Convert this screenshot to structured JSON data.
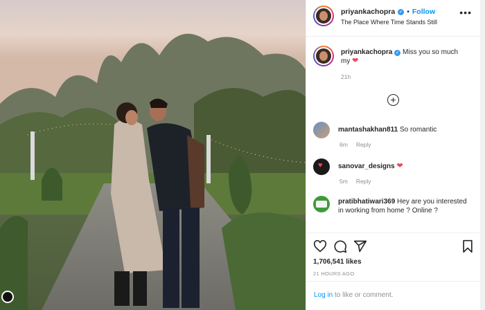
{
  "post": {
    "username": "priyankachopra",
    "follow_label": "Follow",
    "separator": "•",
    "location": "The Place Where Time Stands Still",
    "more_label": "•••"
  },
  "caption": {
    "username": "priyankachopra",
    "text": "Miss you so much my",
    "emoji": "❤",
    "time": "21h"
  },
  "load_more_label": "+",
  "comments": [
    {
      "username": "mantashakhan811",
      "text": "So romantic",
      "emoji": "",
      "time": "6m",
      "reply": "Reply"
    },
    {
      "username": "sanovar_designs",
      "text": "",
      "emoji": "❤",
      "time": "5m",
      "reply": "Reply"
    },
    {
      "username": "pratibhatiwari369",
      "text": "Hey are you interested in working from home ? Online ?",
      "emoji": "",
      "time": "",
      "reply": ""
    }
  ],
  "likes": "1,706,541 likes",
  "time_ago": "21 HOURS AGO",
  "login": {
    "link": "Log in",
    "rest": "to like or comment."
  },
  "colors": {
    "accent": "#0095f6",
    "heart": "#ed4956",
    "verified": "#3897f0"
  }
}
